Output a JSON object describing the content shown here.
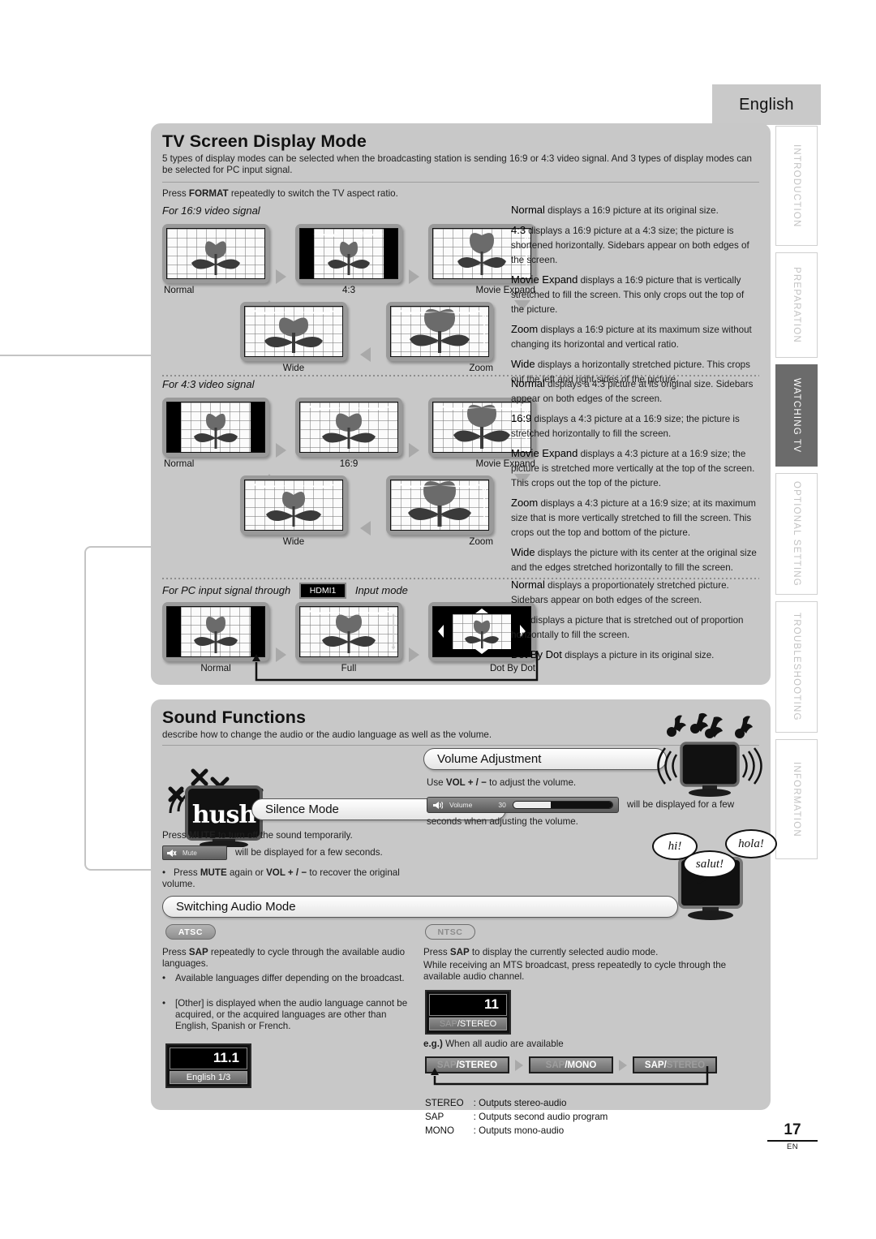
{
  "header": {
    "language_tab": "English"
  },
  "side_tabs": [
    {
      "label": "INTRODUCTION",
      "active": false
    },
    {
      "label": "PREPARATION",
      "active": false
    },
    {
      "label": "WATCHING TV",
      "active": true
    },
    {
      "label": "OPTIONAL SETTING",
      "active": false
    },
    {
      "label": "TROUBLESHOOTING",
      "active": false
    },
    {
      "label": "INFORMATION",
      "active": false
    }
  ],
  "screen_section": {
    "title": "TV Screen Display Mode",
    "intro": "5 types of display modes can be selected when the broadcasting station is sending 16:9 or 4:3 video signal. And 3 types of display modes can be selected for PC input signal.",
    "press_line_a": "Press ",
    "press_line_b": "FORMAT",
    "press_line_c": " repeatedly to switch the TV aspect ratio.",
    "group_169": {
      "heading": "For 16:9 video signal",
      "captions": [
        "Normal",
        "4:3",
        "Movie Expand",
        "Wide",
        "Zoom"
      ],
      "descriptions": [
        {
          "kw": "Normal",
          "text": " displays a 16:9 picture at its original size."
        },
        {
          "kw": "4:3",
          "text": " displays a 16:9 picture at a 4:3 size; the picture is shortened horizontally. Sidebars appear on both edges of the screen."
        },
        {
          "kw": "Movie Expand",
          "text": " displays a 16:9 picture that is vertically stretched to fill the screen. This only crops out the top of the picture."
        },
        {
          "kw": "Zoom",
          "text": " displays a 16:9 picture at its maximum size without changing its horizontal and vertical ratio."
        },
        {
          "kw": "Wide",
          "text": " displays a horizontally stretched picture. This crops out the left and right sides of the picture."
        }
      ]
    },
    "group_43": {
      "heading": "For 4:3 video signal",
      "captions": [
        "Normal",
        "16:9",
        "Movie Expand",
        "Wide",
        "Zoom"
      ],
      "descriptions": [
        {
          "kw": "Normal",
          "text": " displays a 4:3 picture at its original size. Sidebars appear on both edges of the screen."
        },
        {
          "kw": "16:9",
          "text": " displays a 4:3 picture at a 16:9 size; the picture is stretched horizontally to fill the screen."
        },
        {
          "kw": "Movie Expand",
          "text": " displays a 4:3 picture at a 16:9 size; the picture is stretched more vertically at the top of the screen. This crops out the top of the picture."
        },
        {
          "kw": "Zoom",
          "text": " displays a 4:3 picture at a 16:9 size; at its maximum size that is more vertically stretched to fill the screen. This crops out the top and bottom of the picture."
        },
        {
          "kw": "Wide",
          "text": " displays the picture with its center at the original size and the edges stretched horizontally to fill the screen."
        }
      ]
    },
    "group_pc": {
      "heading_a": "For PC input signal through",
      "chip": "HDMI1",
      "heading_b": "Input mode",
      "captions": [
        "Normal",
        "Full",
        "Dot By Dot"
      ],
      "descriptions": [
        {
          "kw": "Normal",
          "text": " displays a proportionately stretched picture. Sidebars appear on both edges of the screen."
        },
        {
          "kw": "Full",
          "text": " displays a picture that is stretched out of proportion horizontally to fill the screen."
        },
        {
          "kw": "Dot By Dot",
          "text": " displays a picture in its original size."
        }
      ]
    }
  },
  "sound_section": {
    "title": "Sound Functions",
    "intro": "describe how to change the audio or  the audio language as well as the volume.",
    "hush_tv_text": "hush",
    "silence": {
      "bar_title": "Silence Mode",
      "line1_a": "Press ",
      "line1_b": "MUTE",
      "line1_c": " to turn off the sound temporarily.",
      "osd_label": "Mute",
      "osd_tail": "will be displayed for a few seconds.",
      "bullet_a": "Press ",
      "bullet_b": "MUTE",
      "bullet_c": " again or ",
      "bullet_d": "VOL + / −",
      "bullet_e": " to recover the original volume."
    },
    "volume": {
      "bar_title": "Volume Adjustment",
      "line1_a": "Use ",
      "line1_b": "VOL + / −",
      "line1_c": " to adjust the volume.",
      "osd_label": "Volume",
      "osd_value": "30",
      "osd_tail_1": "will be displayed for a few",
      "osd_tail_2": "seconds when adjusting the volume."
    },
    "audio_mode": {
      "bar_title": "Switching Audio Mode",
      "atsc": {
        "badge": "ATSC",
        "p1_a": "Press ",
        "p1_b": "SAP",
        "p1_c": " repeatedly to cycle through the available audio languages.",
        "bullets": [
          "Available languages differ depending on the broadcast.",
          "[Other] is displayed when the audio language cannot be acquired, or the acquired languages are other than English, Spanish or French."
        ],
        "osd_channel": "11.1",
        "osd_sub": "English 1/3"
      },
      "ntsc": {
        "badge": "NTSC",
        "p1_a": "Press ",
        "p1_b": "SAP",
        "p1_c": " to display the currently selected audio mode.",
        "p2": "While receiving an MTS broadcast, press repeatedly to cycle through the available audio channel.",
        "osd_channel": "11",
        "osd_sub_dim": "SAP",
        "osd_sub_lit": "/STEREO",
        "eg_a": "e.g.)",
        "eg_b": " When all audio are available",
        "cycle": [
          {
            "dim": "SAP",
            "lit": "/STEREO"
          },
          {
            "dim": "SAP",
            "lit": "/MONO"
          },
          {
            "lit": "SAP/",
            "dim": "STEREO"
          }
        ],
        "legend": [
          {
            "term": "STEREO",
            "desc": ": Outputs stereo-audio"
          },
          {
            "term": "SAP",
            "desc": ": Outputs second audio program"
          },
          {
            "term": "MONO",
            "desc": ": Outputs mono-audio"
          }
        ]
      }
    },
    "speech_bubbles": [
      "hi!",
      "salut!",
      "hola!"
    ]
  },
  "footer": {
    "page": "17",
    "lang_code": "EN"
  }
}
